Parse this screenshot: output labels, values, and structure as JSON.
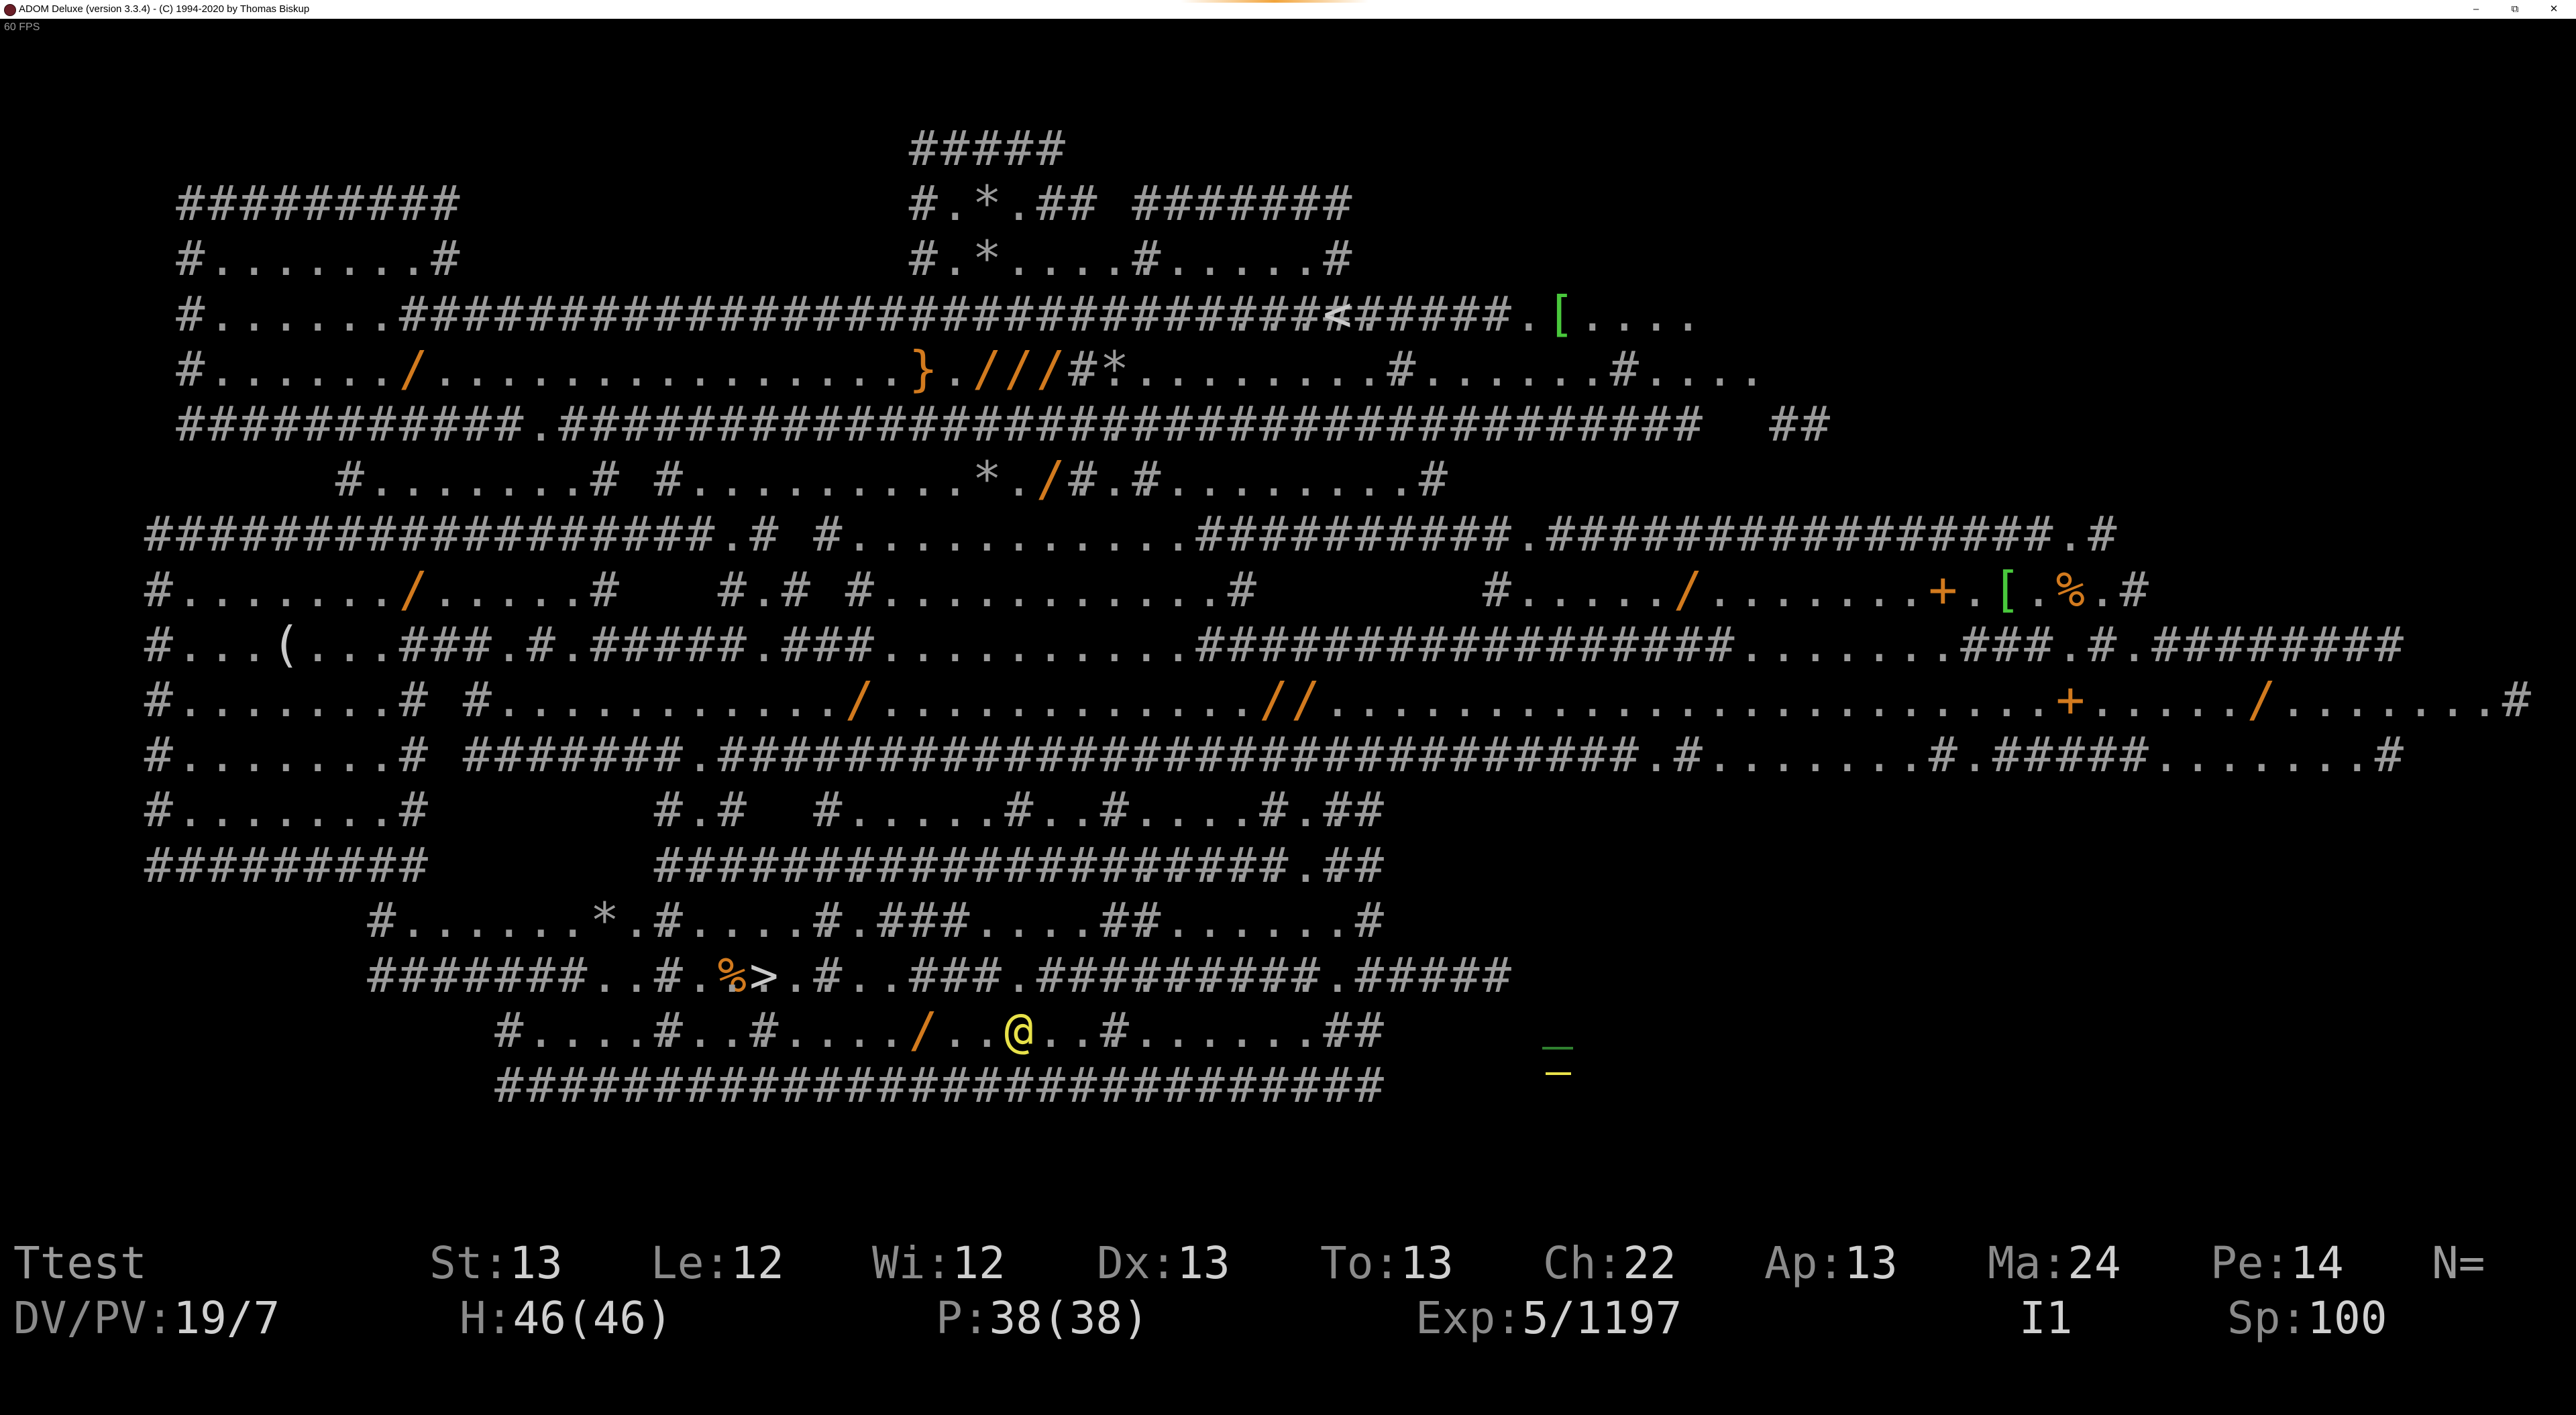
{
  "window": {
    "title": "ADOM Deluxe (version 3.3.4) - (C) 1994-2020 by Thomas Biskup",
    "minimize_glyph": "–",
    "restore_glyph": "⧉",
    "close_glyph": "✕",
    "accent_color": "#f2a43a"
  },
  "fps_label": "60 FPS",
  "colors": {
    "wall": "#9a9a9a",
    "item_orange": "#d27a1e",
    "item_green": "#49c83c",
    "player": "#e8e24a",
    "background": "#000000"
  },
  "map": {
    "rows": [
      {
        "row": 0,
        "col": 25,
        "text": "#####"
      },
      {
        "row": 1,
        "col": 2,
        "text": "#########"
      },
      {
        "row": 1,
        "col": 25,
        "text": "#.*.##"
      },
      {
        "row": 1,
        "col": 32,
        "text": "#######"
      },
      {
        "row": 2,
        "col": 2,
        "text": "#.......#"
      },
      {
        "row": 2,
        "col": 25,
        "text": "#.*....."
      },
      {
        "row": 2,
        "col": 32,
        "text": "#.....#"
      },
      {
        "row": 3,
        "col": 2,
        "text": "#......###################################.[...."
      },
      {
        "row": 3,
        "col": 30,
        "text": "#####...<.#"
      },
      {
        "row": 4,
        "col": 2,
        "text": "#....../...............}.///.................#...."
      },
      {
        "row": 4,
        "col": 30,
        "text": "#*........#"
      },
      {
        "row": 5,
        "col": 2,
        "text": "###########.####################################  ##"
      },
      {
        "row": 5,
        "col": 30,
        "text": "#.#########"
      },
      {
        "row": 6,
        "col": 7,
        "text": "#.......# #.........*./...........#"
      },
      {
        "row": 6,
        "col": 30,
        "text": "#.#"
      },
      {
        "row": 7,
        "col": 1,
        "text": "##################.# #...........##########.################.#"
      },
      {
        "row": 8,
        "col": 1,
        "text": "#......./.....#   #.# #...........#       #...../.......+.[.%.#"
      },
      {
        "row": 9,
        "col": 1,
        "text": "#...(...###.#.#####.###..........#################.......###.#.########"
      },
      {
        "row": 10,
        "col": 1,
        "text": "#.......# #.........../............//.......................+...../.......#"
      },
      {
        "row": 11,
        "col": 1,
        "text": "#.......# #######.#############################.#.......#.#####.......#"
      },
      {
        "row": 12,
        "col": 1,
        "text": "#.......#       #.#"
      },
      {
        "row": 12,
        "col": 22,
        "text": "#.....#.......#.#"
      },
      {
        "row": 12,
        "col": 31,
        "text": "#.......#"
      },
      {
        "row": 13,
        "col": 1,
        "text": "#########       #.#############"
      },
      {
        "row": 13,
        "col": 17,
        "text": "#########"
      },
      {
        "row": 13,
        "col": 22,
        "text": "#.#############.#"
      },
      {
        "row": 13,
        "col": 31,
        "text": "#.......#"
      },
      {
        "row": 14,
        "col": 8,
        "text": "#......*......#"
      },
      {
        "row": 14,
        "col": 17,
        "text": "#.......#"
      },
      {
        "row": 14,
        "col": 22,
        "text": "#.#"
      },
      {
        "row": 14,
        "col": 26,
        "text": "#.....#"
      },
      {
        "row": 14,
        "col": 31,
        "text": "#.......#"
      },
      {
        "row": 15,
        "col": 8,
        "text": "#######....%..#"
      },
      {
        "row": 15,
        "col": 17,
        "text": "#..>....###.#########.#####"
      },
      {
        "row": 15,
        "col": 31,
        "text": "#.......#"
      },
      {
        "row": 16,
        "col": 12,
        "text": "#.......#"
      },
      {
        "row": 16,
        "col": 17,
        "text": "#......./..@.........#"
      },
      {
        "row": 16,
        "col": 31,
        "text": "#.......#"
      },
      {
        "row": 17,
        "col": 12,
        "text": "#########"
      },
      {
        "row": 17,
        "col": 17,
        "text": "######################"
      },
      {
        "row": 17,
        "col": 31,
        "text": "#########"
      }
    ]
  },
  "status": {
    "name": "Ttest",
    "stats": [
      {
        "label": "St:",
        "value": "13"
      },
      {
        "label": "Le:",
        "value": "12"
      },
      {
        "label": "Wi:",
        "value": "12"
      },
      {
        "label": "Dx:",
        "value": "13"
      },
      {
        "label": "To:",
        "value": "13"
      },
      {
        "label": "Ch:",
        "value": "22"
      },
      {
        "label": "Ap:",
        "value": "13"
      },
      {
        "label": "Ma:",
        "value": "24"
      },
      {
        "label": "Pe:",
        "value": "14"
      }
    ],
    "alignment": "N=",
    "dvpv_label": "DV/PV:",
    "dvpv_value": "19/7",
    "hp_label": "H:",
    "hp_value": "46(46)",
    "pp_label": "P:",
    "pp_value": "38(38)",
    "exp_label": "Exp:",
    "exp_value": "5/1197",
    "dungeon_level": "I1",
    "speed_label": "Sp:",
    "speed_value": "100"
  }
}
